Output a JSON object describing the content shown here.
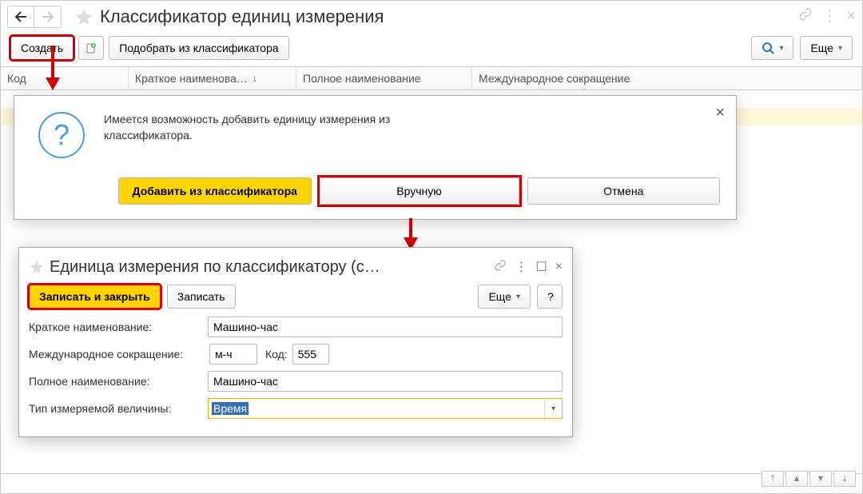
{
  "window": {
    "title": "Классификатор единиц измерения"
  },
  "toolbar": {
    "create": "Создать",
    "pick_from_classifier": "Подобрать из классификатора",
    "more": "Еще"
  },
  "grid": {
    "columns": {
      "code": "Код",
      "short_name": "Краткое наименова…",
      "full_name": "Полное наименование",
      "intl_abbr": "Международное сокращение"
    }
  },
  "confirm": {
    "text": "Имеется возможность добавить единицу измерения из классификатора.",
    "add_from_classifier": "Добавить из классификатора",
    "manual": "Вручную",
    "cancel": "Отмена"
  },
  "form": {
    "title": "Единица измерения по классификатору (с…",
    "save_close": "Записать и закрыть",
    "save": "Записать",
    "more": "Еще",
    "help": "?",
    "labels": {
      "short_name": "Краткое наименование:",
      "intl_abbr": "Международное сокращение:",
      "code": "Код:",
      "full_name": "Полное наименование:",
      "type": "Тип измеряемой величины:"
    },
    "values": {
      "short_name": "Машино-час",
      "intl_abbr": "м-ч",
      "code": "555",
      "full_name": "Машино-час",
      "type": "Время"
    }
  }
}
